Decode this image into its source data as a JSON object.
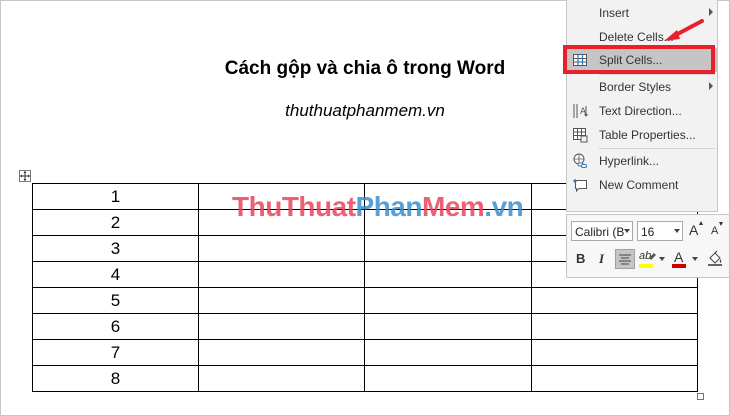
{
  "document": {
    "title": "Cách gộp và chia ô trong Word",
    "subtitle": "thuthuatphanmem.vn",
    "table": {
      "rows": [
        [
          "1",
          "",
          "",
          ""
        ],
        [
          "2",
          "",
          "",
          ""
        ],
        [
          "3",
          "",
          "",
          ""
        ],
        [
          "4",
          "",
          "",
          ""
        ],
        [
          "5",
          "",
          "",
          ""
        ],
        [
          "6",
          "",
          "",
          ""
        ],
        [
          "7",
          "",
          "",
          ""
        ],
        [
          "8",
          "",
          "",
          ""
        ]
      ]
    },
    "watermark": {
      "part1": "Thu",
      "part2": "Thuat",
      "part3": "Phan",
      "part4": "Mem",
      "part5": ".vn"
    }
  },
  "context_menu": {
    "items": [
      {
        "label": "Insert",
        "icon": "none",
        "submenu": true
      },
      {
        "label": "Delete Cells...",
        "icon": "none",
        "submenu": false
      },
      {
        "label": "Split Cells...",
        "icon": "split-cells-icon",
        "submenu": false,
        "highlighted": true
      },
      {
        "label": "Border Styles",
        "icon": "none",
        "submenu": true
      },
      {
        "label": "Text Direction...",
        "icon": "text-direction-icon",
        "submenu": false
      },
      {
        "label": "Table Properties...",
        "icon": "table-properties-icon",
        "submenu": false
      },
      {
        "label": "Hyperlink...",
        "icon": "hyperlink-icon",
        "submenu": false
      },
      {
        "label": "New Comment",
        "icon": "new-comment-icon",
        "submenu": false
      }
    ]
  },
  "mini_toolbar": {
    "font_name": "Calibri (B",
    "font_size": "16",
    "grow_font": "A",
    "shrink_font": "A",
    "bold": "B",
    "italic": "I",
    "highlight_letters": "ab",
    "font_color_letter": "A"
  },
  "colors": {
    "annotation_red": "#e8202a",
    "watermark_red": "#e8455e",
    "watermark_blue": "#3c8fd0",
    "menu_highlight": "#c5c5c5",
    "highlight_yellow": "#ffff00",
    "font_color_red": "#d00000"
  }
}
